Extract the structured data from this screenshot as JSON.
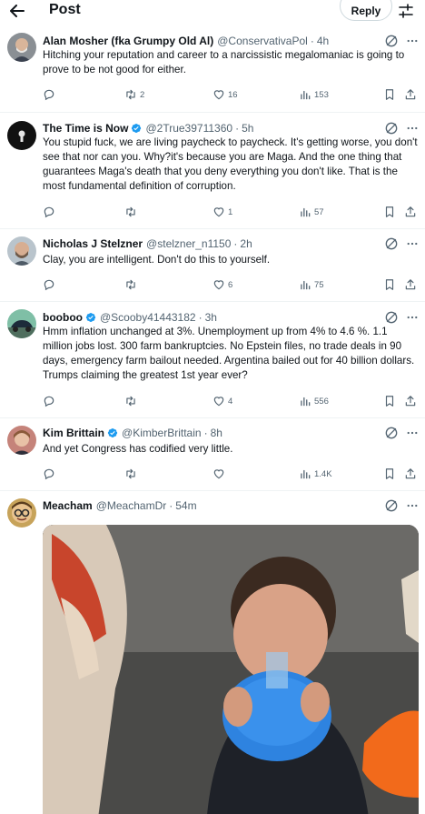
{
  "header": {
    "title": "Post",
    "reply_label": "Reply"
  },
  "tweets": [
    {
      "name": "Alan Mosher (fka Grumpy Old Al)",
      "handle": "@ConservativaPol",
      "time": "4h",
      "text": "Hitching your reputation and career to a narcissistic megalomaniac is going to prove to be not good for either.",
      "reply_count": "",
      "retweet_count": "2",
      "like_count": "16",
      "view_count": "153"
    },
    {
      "name": "The Time is Now",
      "handle": "@2True39711360",
      "time": "5h",
      "text": "You stupid fuck, we are living paycheck to paycheck. It's getting worse, you don't see that nor can you. Why?it's because you are Maga. And the one thing that guarantees Maga's death that you deny everything you don't like. That is the most fundamental definition of corruption.",
      "reply_count": "",
      "retweet_count": "",
      "like_count": "1",
      "view_count": "57"
    },
    {
      "name": "Nicholas J Stelzner",
      "handle": "@stelzner_n1150",
      "time": "2h",
      "text": "Clay, you are intelligent. Don't do this to yourself.",
      "reply_count": "",
      "retweet_count": "",
      "like_count": "6",
      "view_count": "75"
    },
    {
      "name": "booboo",
      "handle": "@Scooby41443182",
      "time": "3h",
      "text": "Hmm inflation unchanged at 3%. Unemployment up from 4% to 4.6 %. 1.1 million jobs lost. 300 farm bankruptcies. No Epstein files, no trade deals in 90 days, emergency farm bailout needed. Argentina bailed out for 40 billion dollars. Trumps claiming the greatest 1st year ever?",
      "reply_count": "",
      "retweet_count": "",
      "like_count": "4",
      "view_count": "556"
    },
    {
      "name": "Kim Brittain",
      "handle": "@KimberBrittain",
      "time": "8h",
      "text": "And yet Congress has codified very little.",
      "reply_count": "",
      "retweet_count": "",
      "like_count": "",
      "view_count": "1.4K"
    },
    {
      "name": "Meacham",
      "handle": "@MeachamDr",
      "time": "54m",
      "text": ""
    }
  ],
  "colors": {
    "verified": "#1d9bf0",
    "text_secondary": "#536471",
    "divider": "#eff3f4"
  }
}
